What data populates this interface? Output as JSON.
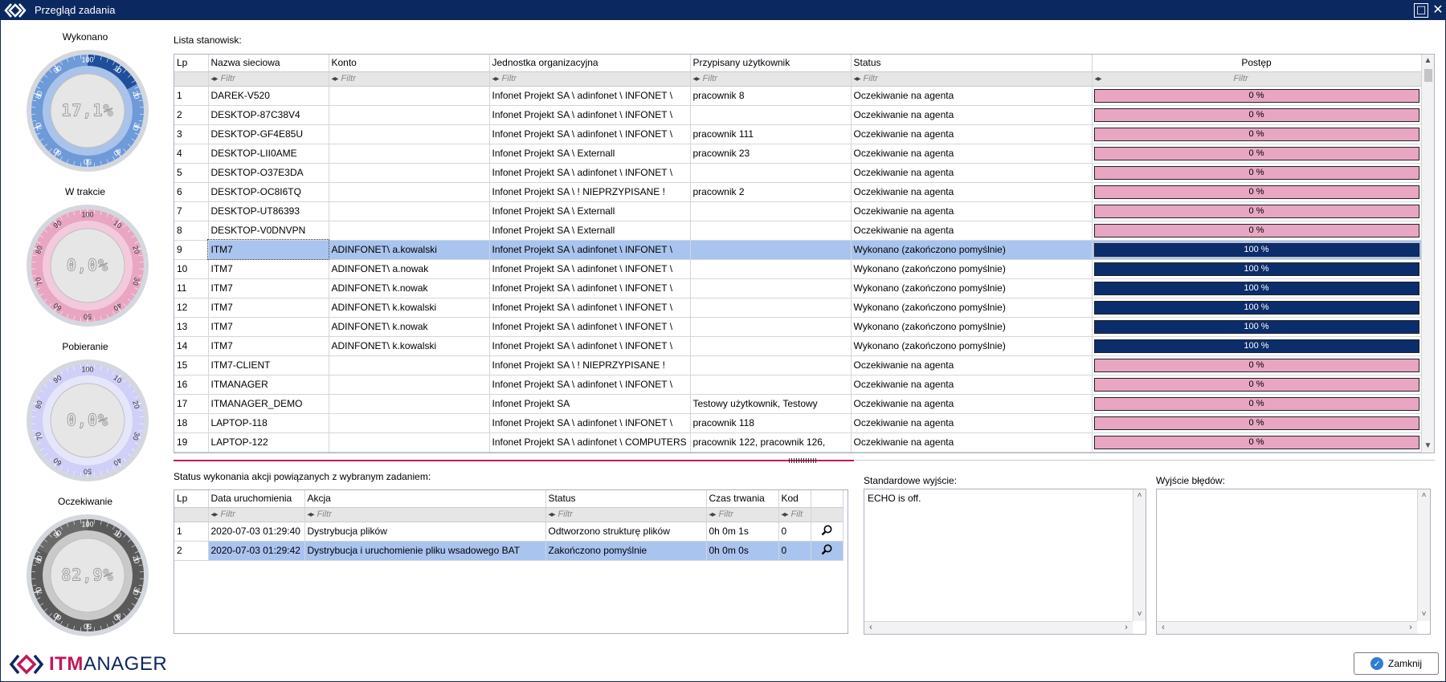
{
  "window": {
    "title": "Przegląd zadania",
    "maximize_glyph": "☐",
    "close_glyph": "✕"
  },
  "gauges": [
    {
      "label": "Wykonano",
      "value_text": "17,1%",
      "fill_fraction": 0.171,
      "theme": "blue",
      "ticks": [
        "100",
        "10",
        "20",
        "30",
        "40",
        "50",
        "60",
        "70",
        "80",
        "90"
      ]
    },
    {
      "label": "W trakcie",
      "value_text": "0,0%",
      "fill_fraction": 0.0,
      "theme": "pink",
      "ticks": [
        "100",
        "10",
        "20",
        "30",
        "40",
        "50",
        "60",
        "70",
        "80",
        "90"
      ]
    },
    {
      "label": "Pobieranie",
      "value_text": "0,0%",
      "fill_fraction": 0.0,
      "theme": "lavender",
      "ticks": [
        "100",
        "10",
        "20",
        "30",
        "40",
        "50",
        "60",
        "70",
        "80",
        "90"
      ]
    },
    {
      "label": "Oczekiwanie",
      "value_text": "82,9%",
      "fill_fraction": 0.829,
      "theme": "gray",
      "ticks": [
        "100",
        "10",
        "20",
        "30",
        "40",
        "50",
        "60",
        "70",
        "80",
        "90"
      ]
    }
  ],
  "stations": {
    "section_label": "Lista stanowisk:",
    "columns": [
      "Lp",
      "Nazwa sieciowa",
      "Konto",
      "Jednostka organizacyjna",
      "Przypisany użytkownik",
      "Status",
      "Postęp"
    ],
    "filter_placeholder": "Filtr",
    "rows": [
      {
        "lp": "1",
        "name": "DAREK-V520",
        "account": "",
        "unit": "Infonet Projekt SA \\ adinfonet \\ INFONET \\",
        "user": "pracownik 8",
        "status": "Oczekiwanie na agenta",
        "progress": "0 %",
        "progress_value": 0
      },
      {
        "lp": "2",
        "name": "DESKTOP-87C38V4",
        "account": "",
        "unit": "Infonet Projekt SA \\ adinfonet \\ INFONET \\",
        "user": "",
        "status": "Oczekiwanie na agenta",
        "progress": "0 %",
        "progress_value": 0
      },
      {
        "lp": "3",
        "name": "DESKTOP-GF4E85U",
        "account": "",
        "unit": "Infonet Projekt SA \\ adinfonet \\ INFONET \\",
        "user": "pracownik 111",
        "status": "Oczekiwanie na agenta",
        "progress": "0 %",
        "progress_value": 0
      },
      {
        "lp": "4",
        "name": "DESKTOP-LII0AME",
        "account": "",
        "unit": "Infonet Projekt SA \\ Externall",
        "user": "pracownik 23",
        "status": "Oczekiwanie na agenta",
        "progress": "0 %",
        "progress_value": 0
      },
      {
        "lp": "5",
        "name": "DESKTOP-O37E3DA",
        "account": "",
        "unit": "Infonet Projekt SA \\ adinfonet \\ INFONET \\",
        "user": "",
        "status": "Oczekiwanie na agenta",
        "progress": "0 %",
        "progress_value": 0
      },
      {
        "lp": "6",
        "name": "DESKTOP-OC8I6TQ",
        "account": "",
        "unit": "Infonet Projekt SA \\ ! NIEPRZYPISANE !",
        "user": "pracownik 2",
        "status": "Oczekiwanie na agenta",
        "progress": "0 %",
        "progress_value": 0
      },
      {
        "lp": "7",
        "name": "DESKTOP-UT86393",
        "account": "",
        "unit": "Infonet Projekt SA \\ Externall",
        "user": "",
        "status": "Oczekiwanie na agenta",
        "progress": "0 %",
        "progress_value": 0
      },
      {
        "lp": "8",
        "name": "DESKTOP-V0DNVPN",
        "account": "",
        "unit": "Infonet Projekt SA \\ Externall",
        "user": "",
        "status": "Oczekiwanie na agenta",
        "progress": "0 %",
        "progress_value": 0
      },
      {
        "lp": "9",
        "name": "ITM7",
        "account": "ADINFONET\\ a.kowalski",
        "unit": "Infonet Projekt SA \\ adinfonet \\ INFONET \\",
        "user": "",
        "status": "Wykonano (zakończono pomyślnie)",
        "progress": "100 %",
        "progress_value": 100,
        "selected": true
      },
      {
        "lp": "10",
        "name": "ITM7",
        "account": "ADINFONET\\ a.nowak",
        "unit": "Infonet Projekt SA \\ adinfonet \\ INFONET \\",
        "user": "",
        "status": "Wykonano (zakończono pomyślnie)",
        "progress": "100 %",
        "progress_value": 100
      },
      {
        "lp": "11",
        "name": "ITM7",
        "account": "ADINFONET\\ k.nowak",
        "unit": "Infonet Projekt SA \\ adinfonet \\ INFONET \\",
        "user": "",
        "status": "Wykonano (zakończono pomyślnie)",
        "progress": "100 %",
        "progress_value": 100
      },
      {
        "lp": "12",
        "name": "ITM7",
        "account": "ADINFONET\\ k.kowalski",
        "unit": "Infonet Projekt SA \\ adinfonet \\ INFONET \\",
        "user": "",
        "status": "Wykonano (zakończono pomyślnie)",
        "progress": "100 %",
        "progress_value": 100
      },
      {
        "lp": "13",
        "name": "ITM7",
        "account": "ADINFONET\\ k.nowak",
        "unit": "Infonet Projekt SA \\ adinfonet \\ INFONET \\",
        "user": "",
        "status": "Wykonano (zakończono pomyślnie)",
        "progress": "100 %",
        "progress_value": 100
      },
      {
        "lp": "14",
        "name": "ITM7",
        "account": "ADINFONET\\ k.kowalski",
        "unit": "Infonet Projekt SA \\ adinfonet \\ INFONET \\",
        "user": "",
        "status": "Wykonano (zakończono pomyślnie)",
        "progress": "100 %",
        "progress_value": 100
      },
      {
        "lp": "15",
        "name": "ITM7-CLIENT",
        "account": "",
        "unit": "Infonet Projekt SA \\ ! NIEPRZYPISANE !",
        "user": "",
        "status": "Oczekiwanie na agenta",
        "progress": "0 %",
        "progress_value": 0
      },
      {
        "lp": "16",
        "name": "ITMANAGER",
        "account": "",
        "unit": "Infonet Projekt SA \\ adinfonet \\ INFONET \\",
        "user": "",
        "status": "Oczekiwanie na agenta",
        "progress": "0 %",
        "progress_value": 0
      },
      {
        "lp": "17",
        "name": "ITMANAGER_DEMO",
        "account": "",
        "unit": "Infonet Projekt SA",
        "user": "Testowy użytkownik, Testowy",
        "status": "Oczekiwanie na agenta",
        "progress": "0 %",
        "progress_value": 0
      },
      {
        "lp": "18",
        "name": "LAPTOP-118",
        "account": "",
        "unit": "Infonet Projekt SA \\ adinfonet \\ INFONET \\",
        "user": "pracownik 118",
        "status": "Oczekiwanie na agenta",
        "progress": "0 %",
        "progress_value": 0
      },
      {
        "lp": "19",
        "name": "LAPTOP-122",
        "account": "",
        "unit": "Infonet Projekt SA \\ adinfonet \\ COMPUTERS",
        "user": "pracownik 122, pracownik 126,",
        "status": "Oczekiwanie na agenta",
        "progress": "0 %",
        "progress_value": 0
      }
    ]
  },
  "actions": {
    "section_label": "Status wykonania akcji powiązanych z wybranym zadaniem:",
    "columns": [
      "Lp",
      "Data uruchomienia",
      "Akcja",
      "Status",
      "Czas trwania",
      "Kod"
    ],
    "filter_placeholder": "Filtr",
    "kod_filter_placeholder": "Filt",
    "rows": [
      {
        "lp": "1",
        "date": "2020-07-03 01:29:40",
        "action": "Dystrybucja plików",
        "status": "Odtworzono strukturę plików",
        "duration": "0h 0m 1s",
        "code": "0"
      },
      {
        "lp": "2",
        "date": "2020-07-03 01:29:42",
        "action": "Dystrybucja i uruchomienie pliku wsadowego BAT",
        "status": "Zakończono pomyślnie",
        "duration": "0h 0m 0s",
        "code": "0",
        "selected": true
      }
    ]
  },
  "stdout": {
    "label": "Standardowe wyjście:",
    "content": "ECHO is off."
  },
  "stderr": {
    "label": "Wyjście błędów:",
    "content": ""
  },
  "close_button": {
    "label": "Zamknij"
  },
  "logo": {
    "prefix": "ITM",
    "suffix": "ANAGER"
  },
  "colors": {
    "accent": "#0c2860",
    "brand_magenta": "#c2175b",
    "selected_row": "#a9c4ee",
    "progress_zero": "#e8a6c3",
    "progress_full": "#0c2d6b"
  }
}
